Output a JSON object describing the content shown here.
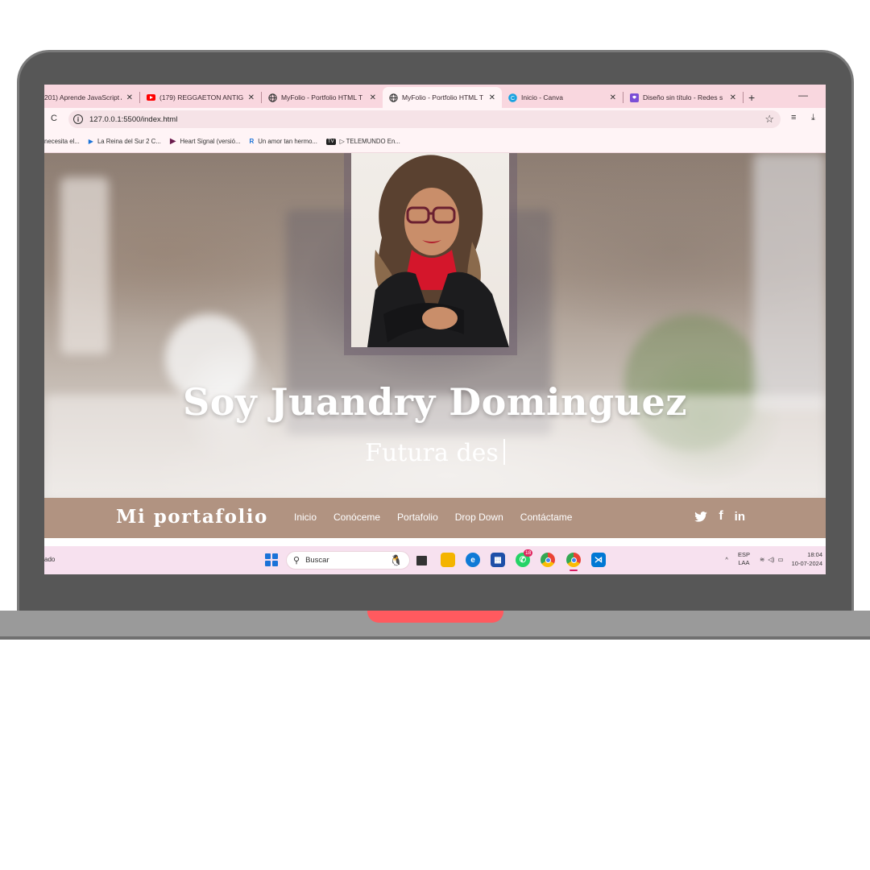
{
  "browser": {
    "tabs": [
      {
        "title": "201) Aprende JavaScript A",
        "icon": "none",
        "active": false
      },
      {
        "title": "(179) REGGAETON ANTIGU",
        "icon": "youtube-icon",
        "active": false
      },
      {
        "title": "MyFolio - Portfolio HTML T",
        "icon": "globe-icon",
        "active": false
      },
      {
        "title": "MyFolio - Portfolio HTML T",
        "icon": "globe-icon",
        "active": true
      },
      {
        "title": "Inicio - Canva",
        "icon": "canva-icon",
        "active": false
      },
      {
        "title": "Diseño sin título - Redes s",
        "icon": "canva-design-icon",
        "active": false
      }
    ],
    "new_tab": "+",
    "minimize": "—",
    "url": "127.0.0.1:5500/index.html",
    "bookmarks": [
      {
        "label": "necesita el..."
      },
      {
        "label": "La Reina del Sur 2 C..."
      },
      {
        "label": "Heart Signal (versió..."
      },
      {
        "label": "Un amor tan hermo..."
      },
      {
        "label": "▷ TELEMUNDO En..."
      }
    ]
  },
  "hero": {
    "title": "Soy Juandry Dominguez",
    "subtitle": "Futura des"
  },
  "nav": {
    "brand": "Mi portafolio",
    "links": [
      "Inicio",
      "Conóceme",
      "Portafolio",
      "Drop Down",
      "Contáctame"
    ],
    "socials": [
      "twitter-icon",
      "facebook-icon",
      "linkedin-icon"
    ]
  },
  "taskbar": {
    "left_text": "ado",
    "search_placeholder": "Buscar",
    "whatsapp_badge": "18",
    "lang_top": "ESP",
    "lang_bottom": "LAA",
    "time": "18:04",
    "date": "10-07-2024"
  },
  "colors": {
    "laptop_body": "#575757",
    "laptop_base": "#9a9a9a",
    "notch": "#ff5a5f",
    "nav_bg": "#b19381",
    "tab_strip": "#f9d7df"
  }
}
